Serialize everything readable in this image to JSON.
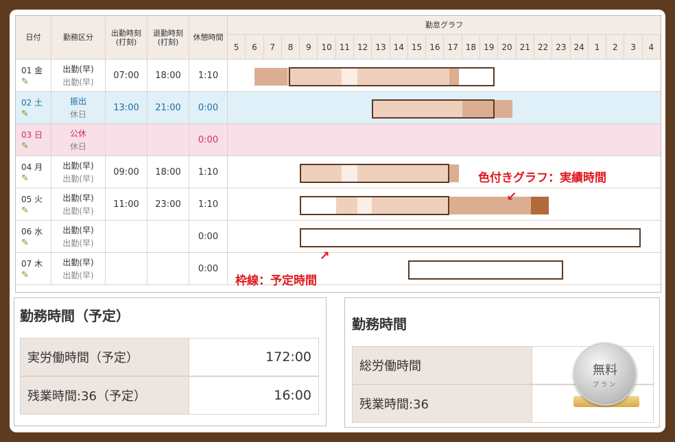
{
  "header": {
    "date": "日付",
    "kind": "勤務区分",
    "clock_in": "出勤時刻\n(打刻)",
    "clock_in_a": "出勤時刻",
    "clock_in_b": "(打刻)",
    "clock_out_a": "退勤時刻",
    "clock_out_b": "(打刻)",
    "break": "休憩時間",
    "graph": "勤怠グラフ",
    "hours": [
      "5",
      "6",
      "7",
      "8",
      "9",
      "10",
      "11",
      "12",
      "13",
      "14",
      "15",
      "16",
      "17",
      "18",
      "19",
      "20",
      "21",
      "22",
      "23",
      "24",
      "1",
      "2",
      "3",
      "4"
    ]
  },
  "rows": [
    {
      "date": "01 金",
      "kind1": "出勤(早)",
      "kind2": "出勤(早)",
      "in": "07:00",
      "out": "18:00",
      "break": "1:10",
      "style": "normal"
    },
    {
      "date": "02 土",
      "kind1": "振出",
      "kind2": "休日",
      "in": "13:00",
      "out": "21:00",
      "break": "0:00",
      "style": "blue"
    },
    {
      "date": "03 日",
      "kind1": "公休",
      "kind2": "休日",
      "in": "",
      "out": "",
      "break": "0:00",
      "style": "pink"
    },
    {
      "date": "04 月",
      "kind1": "出勤(早)",
      "kind2": "出勤(早)",
      "in": "09:00",
      "out": "18:00",
      "break": "1:10",
      "style": "normal"
    },
    {
      "date": "05 火",
      "kind1": "出勤(早)",
      "kind2": "出勤(早)",
      "in": "11:00",
      "out": "23:00",
      "break": "1:10",
      "style": "normal"
    },
    {
      "date": "06 水",
      "kind1": "出勤(早)",
      "kind2": "出勤(早)",
      "in": "",
      "out": "",
      "break": "0:00",
      "style": "normal"
    },
    {
      "date": "07 木",
      "kind1": "出勤(早)",
      "kind2": "出勤(早)",
      "in": "",
      "out": "",
      "break": "0:00",
      "style": "normal"
    }
  ],
  "annotations": {
    "actual": "色付きグラフ：実績時間",
    "planned": "枠線：予定時間"
  },
  "planned_panel": {
    "title": "勤務時間（予定）",
    "items": [
      {
        "label": "実労働時間（予定）",
        "value": "172:00"
      },
      {
        "label": "残業時間:36（予定）",
        "value": "16:00"
      }
    ]
  },
  "actual_panel": {
    "title": "勤務時間",
    "items": [
      {
        "label": "総労働時間",
        "value": ""
      },
      {
        "label": "残業時間:36",
        "value": ""
      }
    ]
  },
  "badge": {
    "main": "無料",
    "sub": "プラン"
  },
  "colors": {
    "frame": "#5e3a1f",
    "bar_light": "#efd0bd",
    "bar_mid": "#dcae91",
    "bar_dark": "#b36a3a",
    "planned_border": "#5a3a24",
    "annotation": "#e01820"
  }
}
